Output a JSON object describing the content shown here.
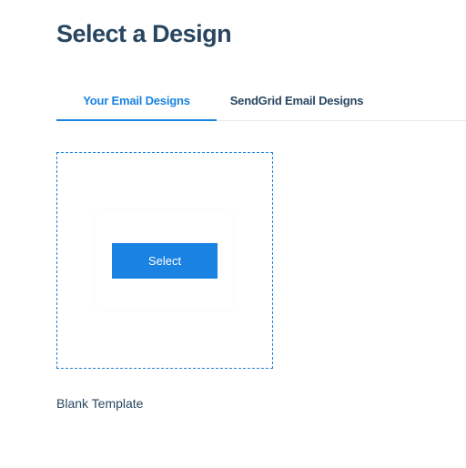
{
  "header": {
    "title": "Select a Design"
  },
  "tabs": [
    {
      "label": "Your Email Designs",
      "active": true
    },
    {
      "label": "SendGrid Email Designs",
      "active": false
    }
  ],
  "templates": [
    {
      "button_label": "Select",
      "name": "Blank Template"
    }
  ]
}
